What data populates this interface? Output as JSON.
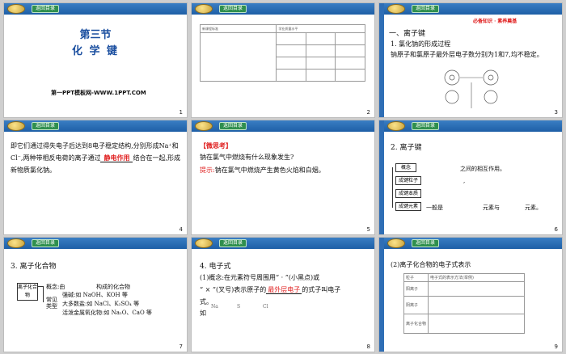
{
  "nav": {
    "back_label": "返回目录"
  },
  "slides": [
    {
      "num": "1",
      "title_sec": "第三节",
      "title_main": "化 学 键",
      "footer": "第一PPT模板网-WWW.1PPT.COM"
    },
    {
      "num": "2",
      "table_header": [
        "新课程标准",
        "学业质量水平"
      ]
    },
    {
      "num": "3",
      "banner": "必备知识 · 素养奠基",
      "h1": "一、离子键",
      "h2": "1. 氯化钠的形成过程",
      "body": "钠原子和氯原子最外层电子数分别为1和7,均不稳定。"
    },
    {
      "num": "4",
      "body_a": "即它们通过得失电子后达到8电子稳定结构,分别形成Na⁺和Cl⁻,两种带相反电荷的离子通过",
      "fill": "静电作用",
      "body_b": "结合在一起,形成新物质氯化钠。"
    },
    {
      "num": "5",
      "think_tag": "【微思考】",
      "question": "钠在氯气中燃烧有什么现象发生?",
      "hint_label": "提示:",
      "hint": "钠在氯气中燃烧产生黄色火焰和白烟。"
    },
    {
      "num": "6",
      "heading": "2. 离子键",
      "rows": [
        "概念",
        "成键粒子",
        "成键本质",
        "成键元素"
      ],
      "notes": [
        "之间的相互作用。",
        ",",
        "一般是",
        "元素与",
        "元素。"
      ]
    },
    {
      "num": "7",
      "heading": "3. 离子化合物",
      "root": "离子化合物",
      "branches": [
        "概念:由",
        "常见类型"
      ],
      "items": [
        "构成的化合物",
        "强碱:如 NaOH、KOH 等",
        "大多数盐:如 NaCl、K₂SO₄ 等",
        "活泼金属氧化物:如 Na₂O、CaO 等"
      ]
    },
    {
      "num": "8",
      "heading": "4. 电子式",
      "line1": "(1)概念:在元素符号周围用“ · ”(小黑点)或",
      "line2": "“ × ”(叉号)表示原子的",
      "fill": "最外层电子",
      "line2b": "的式子叫电子",
      "line3": "式。",
      "line4": "如",
      "examples": [
        "Na",
        "S",
        "Cl"
      ]
    },
    {
      "num": "9",
      "heading": "(2)离子化合物的电子式表示",
      "table_cols": [
        "粒子",
        "电子式的表示方法(举例)"
      ],
      "table_rows": [
        "阳离子",
        "阴离子",
        "离子化合物"
      ]
    }
  ]
}
